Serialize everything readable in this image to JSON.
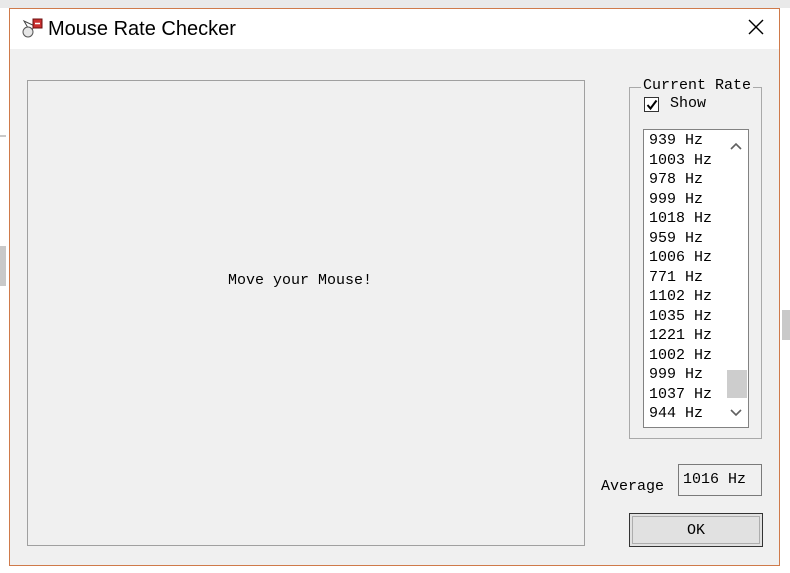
{
  "window": {
    "title": "Mouse Rate Checker",
    "icon": "mouse-app-icon",
    "close_icon": "close-icon",
    "border_color": "#cf7a4a"
  },
  "canvas": {
    "message": "Move your Mouse!"
  },
  "current_rate": {
    "group_label": "Current Rate",
    "show_label": "Show",
    "show_checked": true,
    "rates": [
      "939 Hz",
      "1003 Hz",
      "978 Hz",
      "999 Hz",
      "1018 Hz",
      "959 Hz",
      "1006 Hz",
      "771 Hz",
      "1102 Hz",
      "1035 Hz",
      "1221 Hz",
      "1002 Hz",
      "999 Hz",
      "1037 Hz",
      "944 Hz"
    ]
  },
  "average": {
    "label": "Average",
    "value": "1016 Hz"
  },
  "ok_label": "OK"
}
